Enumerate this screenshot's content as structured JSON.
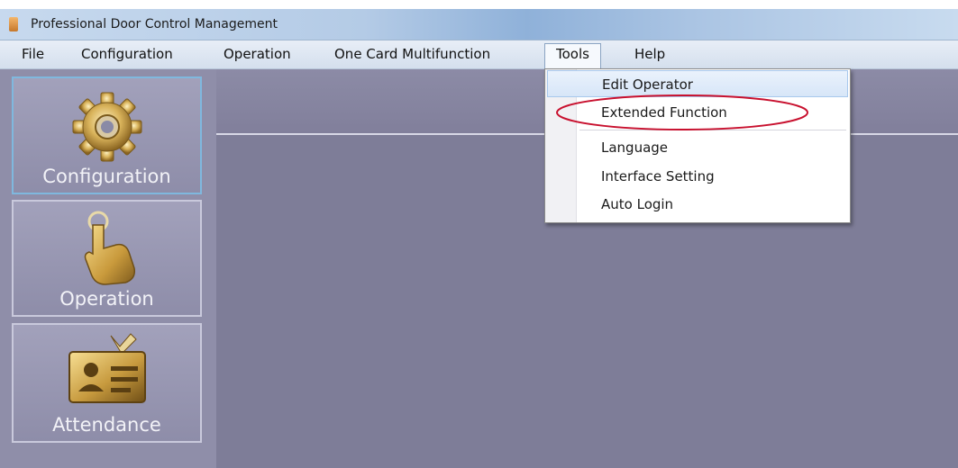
{
  "window": {
    "title": "Professional Door Control Management"
  },
  "menubar": {
    "items": [
      {
        "label": "File"
      },
      {
        "label": "Configuration"
      },
      {
        "label": "Operation"
      },
      {
        "label": "One Card Multifunction"
      },
      {
        "label": "Tools"
      },
      {
        "label": "Help"
      }
    ],
    "open_menu": "Tools"
  },
  "tools_menu": {
    "items": [
      {
        "label": "Edit Operator"
      },
      {
        "label": "Extended Function"
      },
      {
        "label": "Language"
      },
      {
        "label": "Interface Setting"
      },
      {
        "label": "Auto Login"
      }
    ],
    "hovered": "Edit Operator",
    "highlighted": "Extended Function",
    "highlight_color": "#c8102e"
  },
  "sidebar": {
    "items": [
      {
        "label": "Configuration",
        "icon": "gear-icon",
        "active": true
      },
      {
        "label": "Operation",
        "icon": "hand-pointer-icon",
        "active": false
      },
      {
        "label": "Attendance",
        "icon": "id-card-icon",
        "active": false
      }
    ]
  },
  "colors": {
    "sidebar_bg": "#8f8ea9",
    "main_bg": "#7e7d98",
    "icon_gold": "#c9a14a",
    "active_border": "#7fb8de"
  }
}
